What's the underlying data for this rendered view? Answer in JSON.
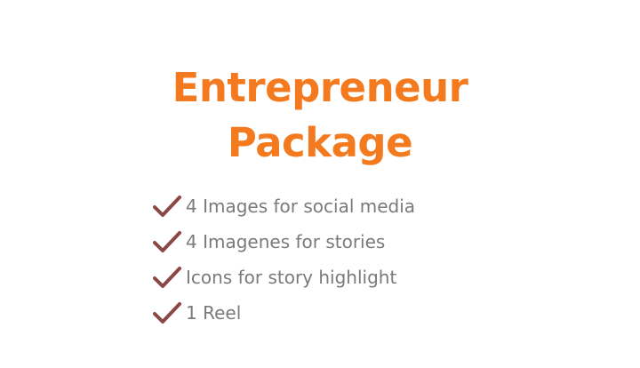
{
  "title": {
    "line1": "Entrepreneur",
    "line2": "Package"
  },
  "features": [
    {
      "icon": "checkmark-icon",
      "text": "4 Images for social media"
    },
    {
      "icon": "checkmark-icon",
      "text": "4 Imagenes for stories"
    },
    {
      "icon": "checkmark-icon",
      "text": "Icons for story highlight"
    },
    {
      "icon": "checkmark-icon",
      "text": "1 Reel"
    }
  ],
  "colors": {
    "title": "#f47a1f",
    "checkmark": "#8a4843",
    "text": "#7a7a7a",
    "background": "#ffffff"
  }
}
